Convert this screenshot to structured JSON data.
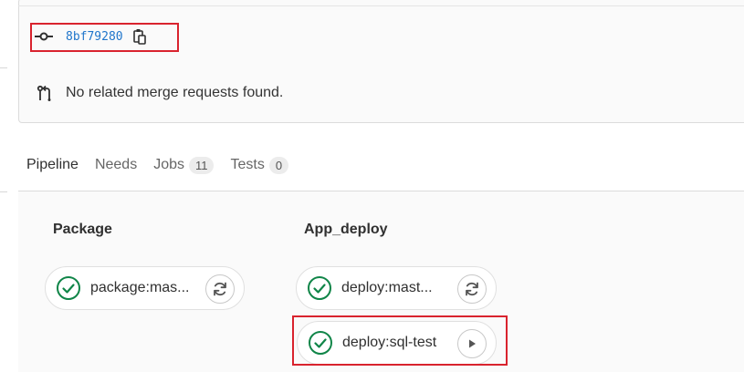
{
  "commit": {
    "sha": "8bf79280",
    "commit_icon": "commit-icon",
    "copy_icon": "copy-icon"
  },
  "merge_requests": {
    "icon": "merge-request-icon",
    "text": "No related merge requests found."
  },
  "tabs": [
    {
      "label": "Pipeline",
      "active": true
    },
    {
      "label": "Needs",
      "active": false
    },
    {
      "label": "Jobs",
      "count": "11",
      "active": false
    },
    {
      "label": "Tests",
      "count": "0",
      "active": false
    }
  ],
  "stages": [
    {
      "title": "Package",
      "jobs": [
        {
          "name": "package:mas...",
          "status": "success",
          "action": "retry"
        }
      ]
    },
    {
      "title": "App_deploy",
      "jobs": [
        {
          "name": "deploy:mast...",
          "status": "success",
          "action": "retry"
        },
        {
          "name": "deploy:sql-test",
          "status": "success",
          "action": "play"
        }
      ]
    }
  ],
  "colors": {
    "success": "#108548",
    "link": "#1f75cb",
    "tab_underline": "#6666c4",
    "highlight": "#d9232e"
  }
}
